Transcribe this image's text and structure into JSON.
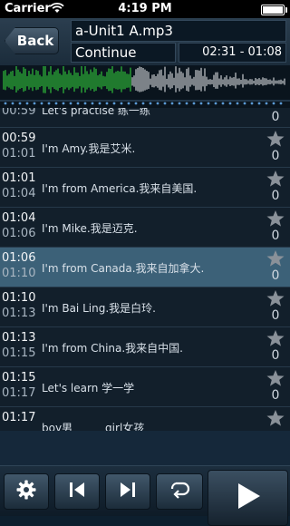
{
  "status": {
    "carrier": "Carrier",
    "time": "4:19 PM"
  },
  "header": {
    "back_label": "Back",
    "title": "a-Unit1 A.mp3",
    "mode": "Continue",
    "range": "02:31 - 01:08"
  },
  "rows": [
    {
      "start": "00:59",
      "end": "",
      "text": "Let's practise 练一练",
      "count": "0",
      "selected": false,
      "partial": true
    },
    {
      "start": "00:59",
      "end": "01:01",
      "text": "I'm Amy.我是艾米.",
      "count": "0",
      "selected": false
    },
    {
      "start": "01:01",
      "end": "01:04",
      "text": "I'm from America.我来自美国.",
      "count": "0",
      "selected": false
    },
    {
      "start": "01:04",
      "end": "01:06",
      "text": "I'm Mike.我是迈克.",
      "count": "0",
      "selected": false
    },
    {
      "start": "01:06",
      "end": "01:10",
      "text": "I'm from Canada.我来自加拿大.",
      "count": "0",
      "selected": true
    },
    {
      "start": "01:10",
      "end": "01:13",
      "text": "I'm Bai Ling.我是白玲.",
      "count": "0",
      "selected": false
    },
    {
      "start": "01:13",
      "end": "01:15",
      "text": "I'm from China.我来自中国.",
      "count": "0",
      "selected": false
    },
    {
      "start": "01:15",
      "end": "01:17",
      "text": "Let's learn 学一学",
      "count": "0",
      "selected": false
    },
    {
      "start": "01:17",
      "end": "",
      "text": "boy男　　　girl女孩",
      "count": "",
      "selected": false
    }
  ],
  "colors": {
    "accent_wave_played": "#2fbf3a",
    "accent_wave_rest": "#c8ccd0",
    "selected_row": "#3c6178",
    "star": "#8a9199"
  },
  "icons": {
    "settings": "gear-icon",
    "previous": "skip-previous-icon",
    "next": "skip-next-icon",
    "repeat": "repeat-icon",
    "play": "play-icon",
    "favorite": "star-icon"
  }
}
